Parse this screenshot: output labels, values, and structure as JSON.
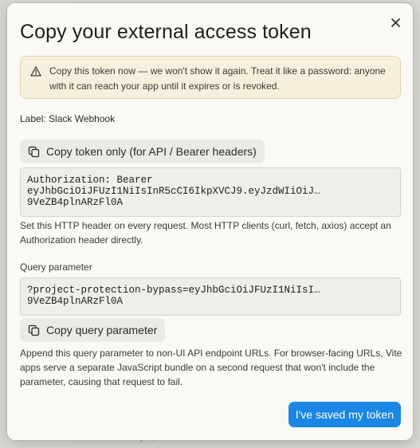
{
  "modal": {
    "title": "Copy your external access token",
    "warning": "Copy this token now — we won't show it again. Treat it like a password: anyone with it can reach your app until it expires or is revoked.",
    "label": "Label: Slack Webhook",
    "copy_token_button": "Copy token only (for API / Bearer headers)",
    "header_line1": "Authorization: Bearer",
    "header_line2": "eyJhbGciOiJFUzI1NiIsInR5cCI6IkpXVCJ9.eyJzdWIiOiJ…",
    "header_line3": "9VeZB4plnARzFl0A",
    "header_help": "Set this HTTP header on every request. Most HTTP clients (curl, fetch, axios) accept an Authorization header directly.",
    "query_label": "Query parameter",
    "query_line1": "?project-protection-bypass=eyJhbGciOiJFUzI1NiIsI…",
    "query_line2": "9VeZB4plnARzFl0A",
    "copy_query_button": "Copy query parameter",
    "query_help": "Append this query parameter to non-UI API endpoint URLs. For browser-facing URLs, Vite apps serve a separate JavaScript bundle on a second request that won't include the parameter, causing that request to fail.",
    "confirm_button": "I've saved my token"
  },
  "background": {
    "footer_text": "Revoked May 3, 2025"
  },
  "colors": {
    "primary": "#1a87e5",
    "warning_bg": "#f6efdc",
    "warning_border": "#e3d5ad"
  },
  "icons": {
    "close": "close-icon",
    "warning": "warning-triangle-icon",
    "copy": "copy-icon"
  }
}
